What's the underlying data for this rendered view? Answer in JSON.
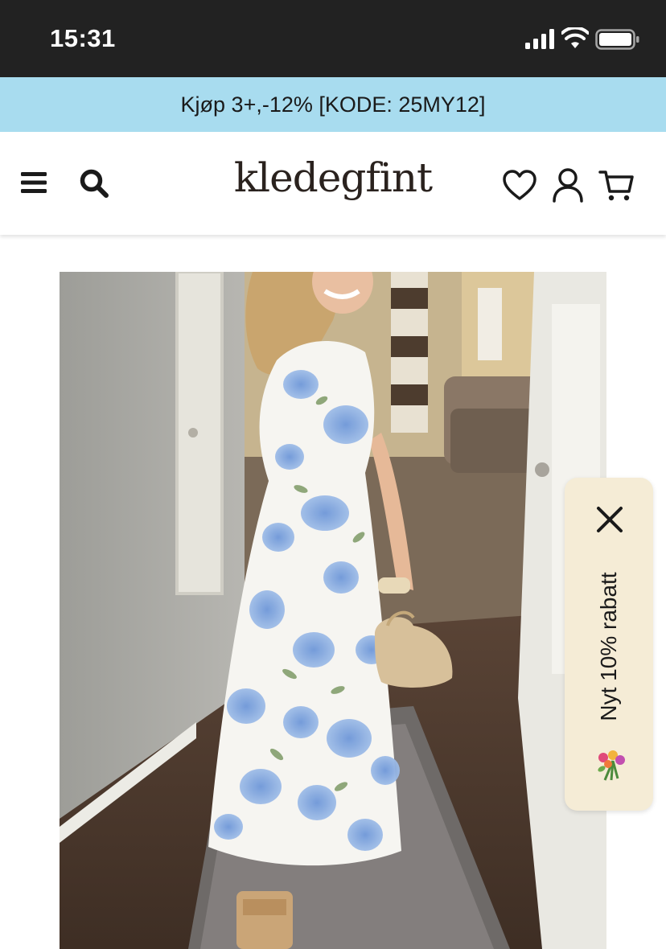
{
  "status_bar": {
    "time": "15:31"
  },
  "promo": {
    "text": "Kjøp 3+,-12% [KODE: 25MY12]",
    "background": "#a8dcef"
  },
  "header": {
    "logo": "kledegfint",
    "icons": [
      "menu-icon",
      "search-icon",
      "heart-icon",
      "user-icon",
      "cart-icon"
    ]
  },
  "product": {
    "image_alt": "Woman in white maxi dress with blue floral print holding a woven bag in a hallway"
  },
  "discount_tab": {
    "label": "Nyt 10% rabatt",
    "close_icon": "close-icon",
    "emoji_icon": "flower-bouquet-icon",
    "background": "#f5ecd6"
  }
}
